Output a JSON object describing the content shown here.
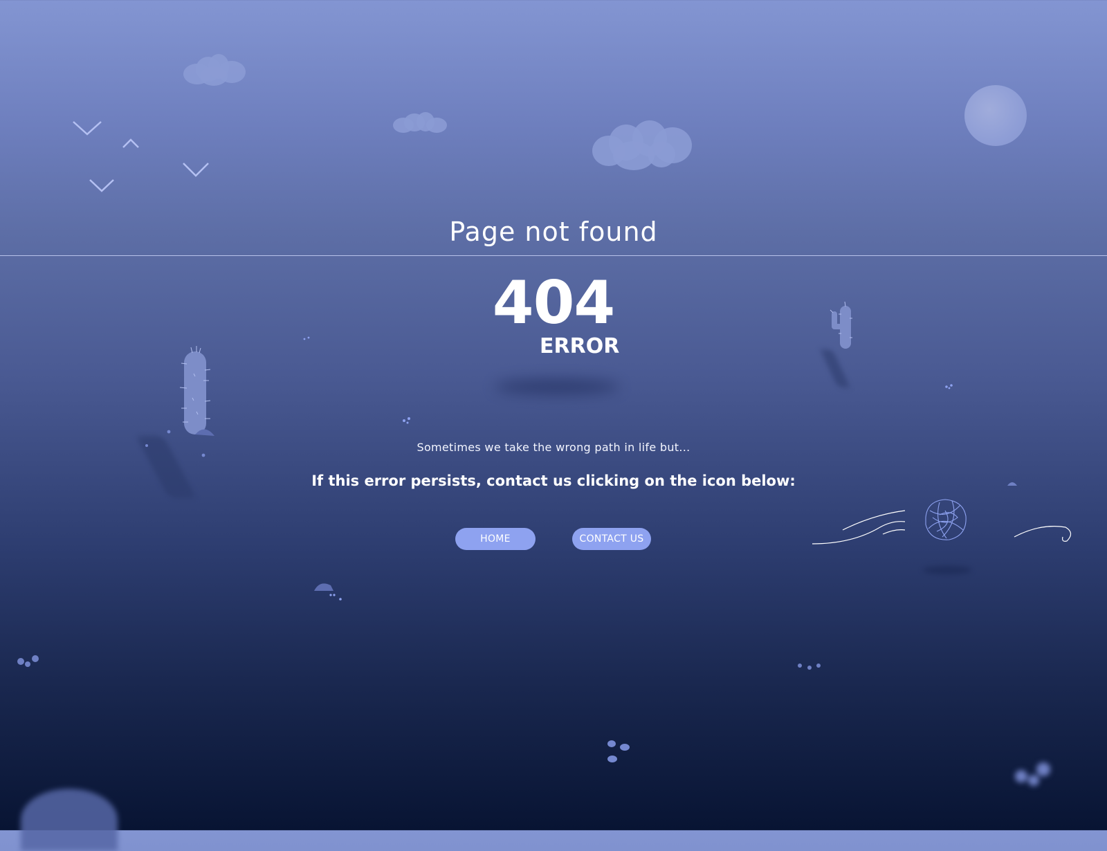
{
  "page": {
    "title": "Page not found",
    "code": "404",
    "error_word": "ERROR",
    "tagline": "Sometimes we take the wrong path in life but...",
    "instruction": "If this error persists, contact us clicking on the icon below:"
  },
  "buttons": {
    "home": "HOME",
    "contact": "CONTACT US"
  },
  "colors": {
    "sky_top": "#8395d2",
    "ground_bottom": "#081433",
    "button": "#8ea2f0",
    "accent_light": "#b8c2ea"
  },
  "icons": [
    "cloud-icon",
    "moon-icon",
    "bird-icon",
    "cactus-icon",
    "tumbleweed-icon",
    "wind-icon",
    "rock-icon"
  ]
}
